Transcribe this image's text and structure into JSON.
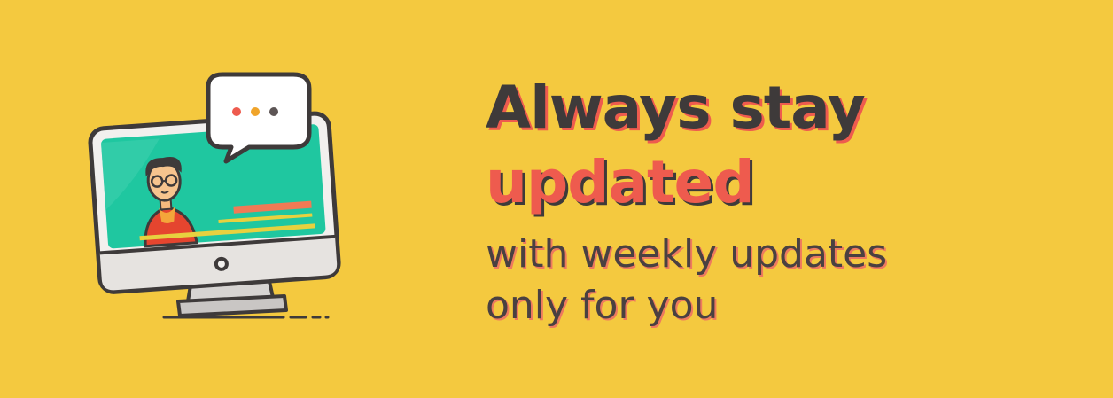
{
  "banner": {
    "headline_line1": "Always stay",
    "headline_line2": "updated",
    "subtext_line1": "with weekly updates",
    "subtext_line2": "only for you"
  },
  "illustration": {
    "icon": "computer-with-chat-bubble-icon",
    "bubble_text": "..."
  },
  "colors": {
    "background": "#F4C93F",
    "dark_text": "#3E3A3A",
    "accent_red": "#EE5B4E",
    "screen_green": "#1FC7A0"
  }
}
